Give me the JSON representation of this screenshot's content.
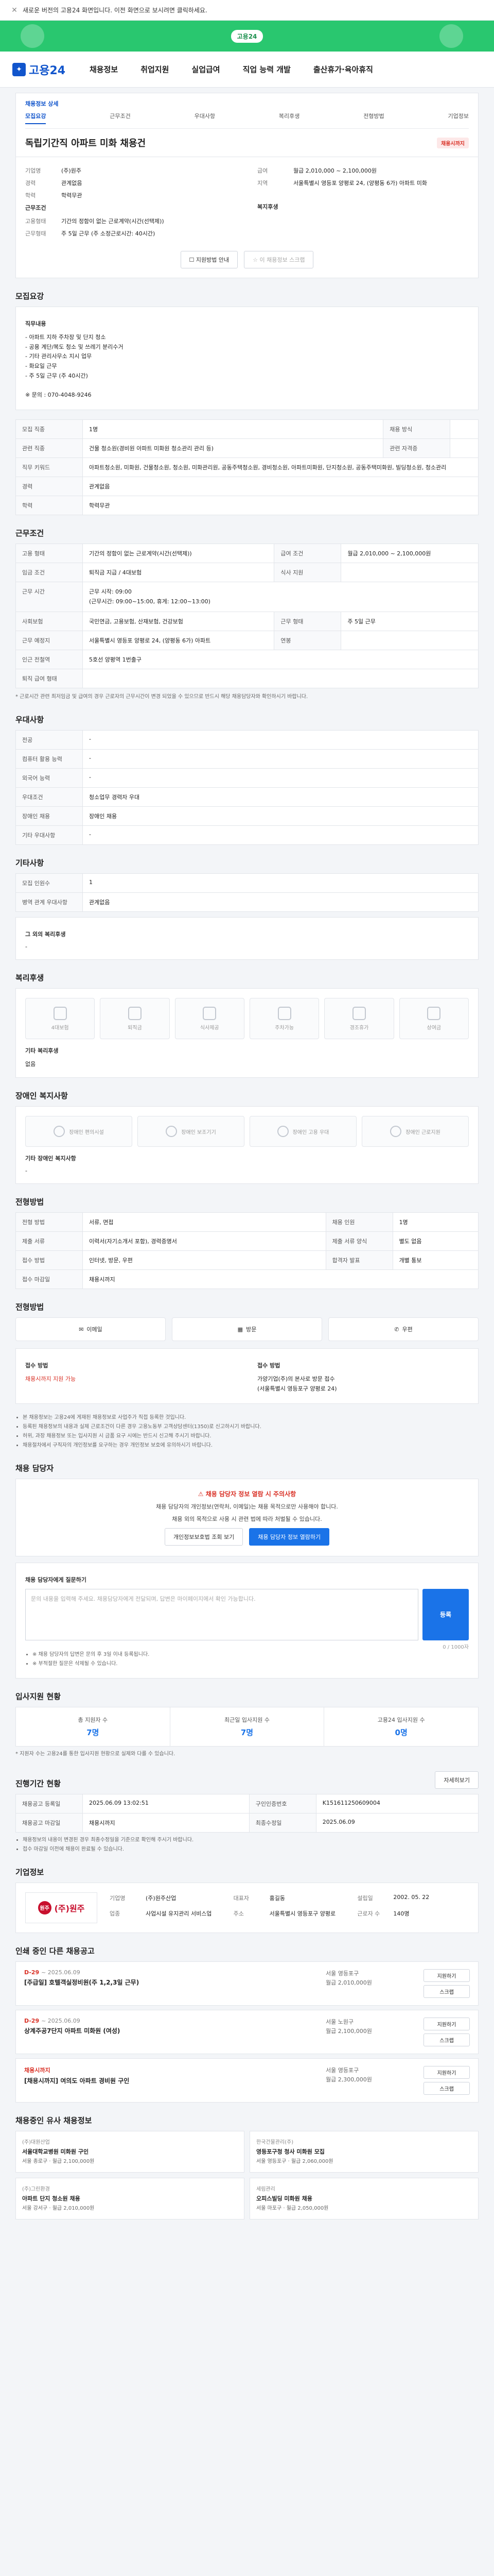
{
  "notice": {
    "text": "새로운 버전의 고용24 화면입니다. 이전 화면으로 보시려면 클릭하세요."
  },
  "promo": {
    "label": "고용24"
  },
  "gnb": {
    "logo": "고용24",
    "items": [
      "채용정보",
      "취업지원",
      "실업급여",
      "직업 능력 개발",
      "출산휴가·육아휴직"
    ]
  },
  "breadcrumb": {
    "left": "채용정보 상세",
    "items": [
      "모집요강",
      "근무조건",
      "우대사항",
      "복리후생",
      "전형방법",
      "기업정보"
    ]
  },
  "job": {
    "title": "독립기간직 아파트 미화 채용건",
    "badge": "채용시까지",
    "summary_left": [
      {
        "k": "기업명",
        "v": "(주)원주"
      },
      {
        "k": "경력",
        "v": "관계없음"
      },
      {
        "k": "학력",
        "v": "학력무관"
      }
    ],
    "summary_right": [
      {
        "k": "급여",
        "v": "월급 2,010,000 ~ 2,100,000원"
      },
      {
        "k": "지역",
        "v": "서울특별시 영등포 양평로 24, (양평동 6가) 아파트 미화"
      }
    ],
    "cond_title": "근무조건",
    "cond_left": [
      {
        "k": "고용형태",
        "v": "기간의 정함이 없는 근로계약(시간(선택제))"
      },
      {
        "k": "근무형태",
        "v": "주 5일 근무 (주 소정근로시간: 40시간)"
      }
    ],
    "cond_right_title": "복지후생",
    "btn_apply": "지원방법 안내",
    "btn_scrap": "이 채용정보 스크랩"
  },
  "sections": {
    "recruit": "모집요강",
    "work": "근무조건",
    "pref": "우대사항",
    "other": "기타사항",
    "welfare": "복리후생",
    "welfare2": "장애인 복지사항",
    "process": "전형방법",
    "contact": "채용 담당자",
    "statistics": "입사지원 현황",
    "progress": "진행기간 현황",
    "company": "기업정보",
    "other_jobs": "인쇄 중인 다른 채용공고",
    "similar": "채용중인 유사 채용정보"
  },
  "recruit": {
    "duty_label": "직무내용",
    "duty": "- 아파트 지하 주차장 및 단지 청소\n- 공용 계단/복도 청소 및 쓰레기 분리수거\n- 기타 관리사무소 지시 업무\n- 화요일 근무\n- 주 5일 근무 (주 40시간)\n\n※ 문의 : 070-4048-9246",
    "rows": [
      {
        "k": "모집 직종",
        "v": "1명"
      },
      {
        "k": "관련 직종",
        "v": "건물 청소원(경비원 아파트 미화원 청소관리 관리 등)"
      },
      {
        "k": "직무 키워드",
        "v": "아파트청소원, 미화원, 건물청소원, 청소원, 미화관리원, 공동주택청소원, 경비청소원, 아파트미화원, 단지청소원, 공동주택미화원, 빌딩청소원, 청소관리"
      },
      {
        "k": "경력",
        "v": "관계없음"
      },
      {
        "k": "학력",
        "v": "학력무관"
      }
    ],
    "right_rows": [
      {
        "k": "채용 방식",
        "v": ""
      },
      {
        "k": "관련 자격증",
        "v": ""
      }
    ]
  },
  "work": {
    "rows": [
      {
        "k": "고용 형태",
        "v": "기간의 정함이 없는 근로계약(시간(선택제))"
      },
      {
        "k": "임금 조건",
        "v": "퇴직금 지급 / 4대보험"
      },
      {
        "k": "근무 시간",
        "v": "근무 시작: 09:00\n(근무시간: 09:00~15:00, 휴게: 12:00~13:00)"
      },
      {
        "k": "사회보험",
        "v": "국민연금, 고용보험, 산재보험, 건강보험"
      },
      {
        "k": "근무 예정지",
        "v": "서울특별시 영등포 양평로 24, (양평동 6가) 아파트"
      },
      {
        "k": "인근 전철역",
        "v": "5호선 양평역 1번출구"
      },
      {
        "k": "퇴직 급여 형태",
        "v": ""
      }
    ],
    "right_rows": [
      {
        "k": "급여 조건",
        "v": "월급 2,010,000 ~ 2,100,000원"
      },
      {
        "k": "식사 지원",
        "v": ""
      },
      {
        "k": "근무 형태",
        "v": "주 5일 근무"
      },
      {
        "k": "연봉",
        "v": ""
      }
    ],
    "note": "* 근로시간 관련 최저임금 및 급여의 경우 근로자의 근무시간이 변경 되었을 수 있으므로 반드시 해당 채용담당자와 확인하시기 바랍니다."
  },
  "pref": {
    "rows": [
      {
        "k": "전공",
        "v": "-"
      },
      {
        "k": "컴퓨터 활용 능력",
        "v": "-"
      },
      {
        "k": "외국어 능력",
        "v": "-"
      },
      {
        "k": "우대조건",
        "v": "청소업무 경력자 우대"
      },
      {
        "k": "장애인 채용",
        "v": "장애인 채용"
      },
      {
        "k": "기타 우대사항",
        "v": "-"
      }
    ]
  },
  "other": {
    "rows": [
      {
        "k": "모집 인원수",
        "v": "1"
      },
      {
        "k": "병역 관계 우대사항",
        "v": "관계없음"
      }
    ],
    "extra_label": "그 외의 복리후생",
    "extra_value": "-"
  },
  "welfare": {
    "items": [
      "4대보험",
      "퇴직금",
      "식사제공",
      "주차가능",
      "경조휴가",
      "상여금"
    ],
    "extra_label": "기타 복리후생",
    "extra_value": "없음"
  },
  "welfare2": {
    "items": [
      "장애인 편의시설",
      "장애인 보조기기",
      "장애인 고용 우대",
      "장애인 근로지원"
    ],
    "note_label": "기타 장애인 복지사항",
    "note_value": "-"
  },
  "process": {
    "rows": [
      {
        "k": "전형 방법",
        "v": "서류, 면접"
      },
      {
        "k": "제출 서류",
        "v": "이력서(자기소개서 포함), 경력증명서"
      },
      {
        "k": "접수 방법",
        "v": "인터넷, 방문, 우편"
      },
      {
        "k": "접수 마감일",
        "v": "채용시까지"
      }
    ],
    "right_rows": [
      {
        "k": "채용 인원",
        "v": "1명"
      },
      {
        "k": "제출 서류 양식",
        "v": "별도 없음"
      },
      {
        "k": "합격자 발표",
        "v": "개별 통보"
      }
    ],
    "methods": [
      "이메일",
      "방문",
      "우편"
    ],
    "apply_label": "접수 방법",
    "apply_text": "채용시까지 지원 가능",
    "contact_label": "접수 방법",
    "contact_text": "가양기업(주)의 본사로 방문 접수\n(서울특별시 영등포구 양평로 24)",
    "notes": [
      "본 채용정보는 고용24에 게재된 채용정보로 사업주가 직접 등록한 것입니다.",
      "등록된 채용정보의 내용과 실제 근로조건이 다른 경우 고용노동부 고객상담센터(1350)로 신고하시기 바랍니다.",
      "허위, 과장 채용정보 또는 입사지원 시 금품 요구 시에는 반드시 신고해 주시기 바랍니다.",
      "채용절차에서 구직자의 개인정보를 요구하는 경우 개인정보 보호에 유의하시기 바랍니다."
    ]
  },
  "contact": {
    "warn": "채용 담당자 정보 열람 시 주의사항",
    "desc": "채용 담당자의 개인정보(연락처, 이메일)는 채용 목적으로만 사용해야 합니다.",
    "desc2": "채용 외의 목적으로 사용 시 관련 법에 따라 처벌될 수 있습니다.",
    "btn_view": "개인정보보호법 조회 보기",
    "btn_agree": "채용 담당자 정보 열람하기",
    "qa_label": "채용 담당자에게 질문하기",
    "qa_placeholder": "문의 내용을 입력해 주세요. 채용담당자에게 전달되며, 답변은 마이페이지에서 확인 가능합니다.",
    "qa_count": "0 / 1000자",
    "send": "등록",
    "footnotes": [
      "※ 채용 담당자의 답변은 문의 후 3일 이내 등록됩니다.",
      "※ 부적절한 질문은 삭제될 수 있습니다."
    ]
  },
  "statistics": {
    "items": [
      {
        "label": "총 지원자 수",
        "value": "7명"
      },
      {
        "label": "최근일 입사지원 수",
        "value": "7명"
      },
      {
        "label": "고용24 입사지원 수",
        "value": "0명"
      }
    ],
    "note": "* 지원자 수는 고용24를 통한 입사지원 현황으로 실제와 다를 수 있습니다."
  },
  "progress": {
    "rows": [
      {
        "k": "채용공고 등록일",
        "v": "2025.06.09 13:02:51"
      },
      {
        "k": "채용공고 마감일",
        "v": "채용시까지"
      }
    ],
    "right_rows": [
      {
        "k": "구인인증번호",
        "v": "K151611250609004"
      },
      {
        "k": "최종수정일",
        "v": "2025.06.09"
      }
    ],
    "notes": [
      "채용정보의 내용이 변경된 경우 최종수정일을 기준으로 확인해 주시기 바랍니다.",
      "접수 마감일 이전에 채용이 완료될 수 있습니다."
    ],
    "more": "자세히보기"
  },
  "company": {
    "logo_text": "(주)원주",
    "logo_seal": "원주",
    "rows": [
      {
        "k": "기업명",
        "v": "(주)원주산업"
      },
      {
        "k": "대표자",
        "v": "홍길동"
      },
      {
        "k": "업종",
        "v": "사업시설 유지관리 서비스업"
      },
      {
        "k": "주소",
        "v": "서울특별시 영등포구 양평로"
      },
      {
        "k": "근로자 수",
        "v": "140명"
      },
      {
        "k": "설립일",
        "v": "2002. 05. 22"
      }
    ]
  },
  "other_jobs": [
    {
      "dday": "D-29",
      "date": "~ 2025.06.09",
      "title": "[주급일] 호텔객실정비원(주 1,2,3일 근무)",
      "meta1": "서울 영등포구",
      "meta2": "월급 2,010,000원",
      "b1": "지원하기",
      "b2": "스크랩"
    },
    {
      "dday": "D-29",
      "date": "~ 2025.06.09",
      "title": "상계주공7단지 아파트 미화원 (여성)",
      "meta1": "서울 노원구",
      "meta2": "월급 2,100,000원",
      "b1": "지원하기",
      "b2": "스크랩"
    },
    {
      "dday": "채용시까지",
      "date": "",
      "title": "[채용시까지] 여의도 아파트 경비원 구인",
      "meta1": "서울 영등포구",
      "meta2": "월급 2,300,000원",
      "b1": "지원하기",
      "b2": "스크랩"
    }
  ],
  "similar_jobs": [
    {
      "co": "(주)대원산업",
      "title": "서울대학교병원 미화원 구인",
      "meta": "서울 종로구 · 월급 2,100,000원"
    },
    {
      "co": "한국건물관리(주)",
      "title": "영등포구청 청사 미화원 모집",
      "meta": "서울 영등포구 · 월급 2,060,000원"
    },
    {
      "co": "(주)그린환경",
      "title": "아파트 단지 청소원 채용",
      "meta": "서울 강서구 · 월급 2,010,000원"
    },
    {
      "co": "세림관리",
      "title": "오피스빌딩 미화원 채용",
      "meta": "서울 마포구 · 월급 2,050,000원"
    }
  ]
}
